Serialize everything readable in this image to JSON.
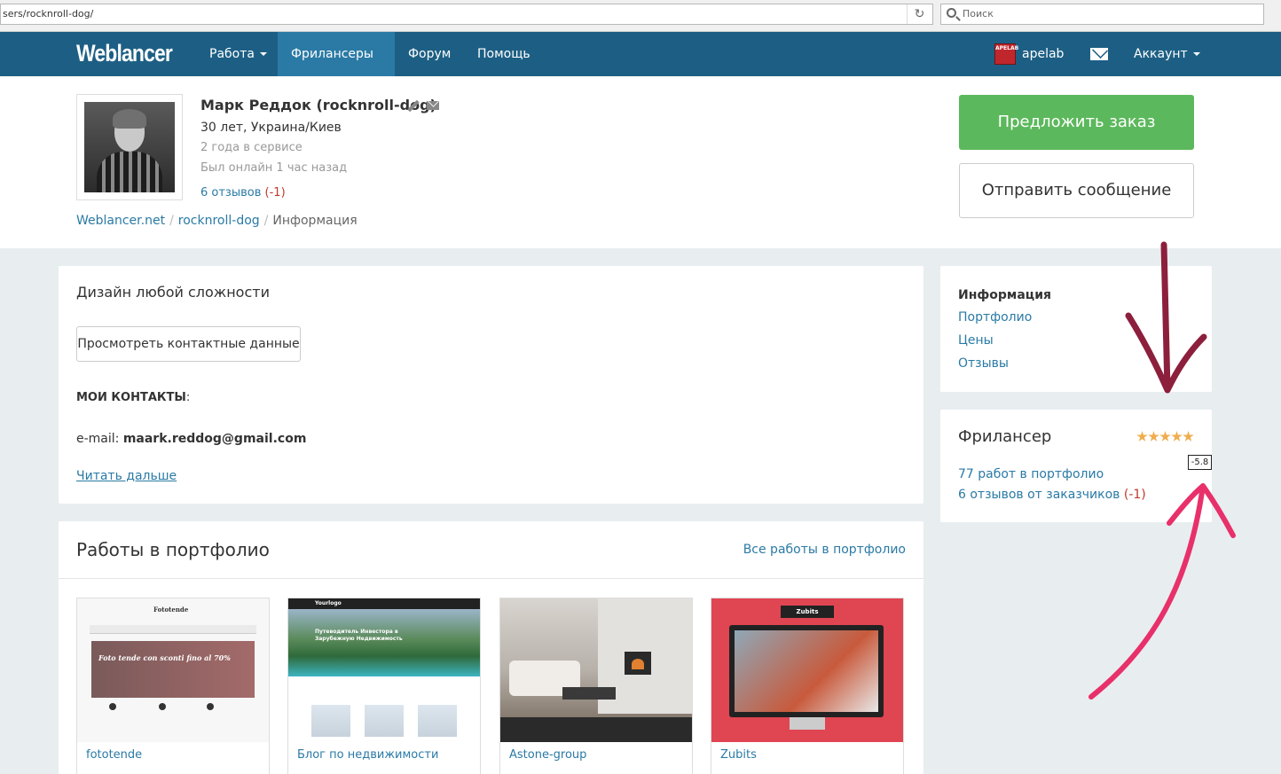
{
  "browser": {
    "url": "sers/rocknroll-dog/",
    "search_placeholder": "Поиск"
  },
  "navbar": {
    "logo": "Weblancer",
    "items": [
      "Работа",
      "Фрилансеры",
      "Форум",
      "Помощь"
    ],
    "active_item": "Фрилансеры",
    "avatar_text": "APELAB",
    "user_name": "apelab",
    "account_label": "Аккаунт"
  },
  "profile": {
    "name": "Марк Реддок (rocknroll-dog)",
    "location": "30 лет, Украина/Киев",
    "service_time": "2 года в сервисе",
    "last_online": "Был онлайн 1 час назад",
    "reviews_text": "6 отзывов",
    "reviews_negative": "(-1)",
    "order_button": "Предложить заказ",
    "message_button": "Отправить сообщение"
  },
  "breadcrumb": [
    "Weblancer.net",
    "rocknroll-dog",
    "Информация"
  ],
  "about": {
    "tagline": "Дизайн любой сложности",
    "contacts_button": "Просмотреть контактные данные",
    "contacts_title": "МОИ КОНТАКТЫ",
    "contacts_colon": ":",
    "email_label": "e-mail: ",
    "email_value": "maark.reddog@gmail.com",
    "read_more": "Читать дальше"
  },
  "portfolio": {
    "title": "Работы в портфолио",
    "all_link": "Все работы в портфолио",
    "items": [
      {
        "caption": "fototende",
        "brand": "Fototende",
        "hero": "Foto tende con sconti fino al 70%"
      },
      {
        "caption": "Блог по недвижимости",
        "brand": "Yourlogo",
        "hero": "Путеводитель Инвестора в Зарубежную Недвижимость"
      },
      {
        "caption": "Astone-group"
      },
      {
        "caption": "Zubits",
        "brand": "Zubits"
      }
    ]
  },
  "sidebar": {
    "nav": [
      "Информация",
      "Портфолио",
      "Цены",
      "Отзывы"
    ],
    "freelancer_title": "Фрилансер",
    "rating_stars": 5,
    "rating_value": "-5.8",
    "portfolio_count_text": "77 работ в портфолио",
    "client_reviews_text": "6 отзывов от заказчиков",
    "client_reviews_negative": "(-1)"
  },
  "colors": {
    "navbar": "#1d5f84",
    "navbar_active": "#2a7aa5",
    "link": "#2a7aa5",
    "order_button": "#5cb85c",
    "negative": "#c0392b",
    "star": "#f0ad4e",
    "annotation_down_arrow": "#8c1f3c",
    "annotation_up_arrow": "#e8306a"
  }
}
